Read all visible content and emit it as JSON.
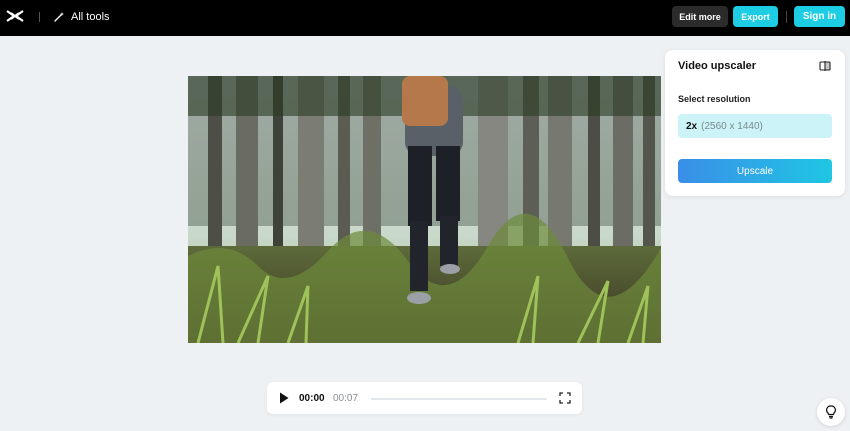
{
  "header": {
    "all_tools_label": "All tools",
    "edit_more_label": "Edit more",
    "export_label": "Export",
    "sign_in_label": "Sign in"
  },
  "panel": {
    "title": "Video upscaler",
    "resolution_label": "Select resolution",
    "resolution_multiplier": "2x",
    "resolution_dimensions": "(2560 x 1440)",
    "upscale_label": "Upscale"
  },
  "player": {
    "current_time": "00:00",
    "duration": "00:07",
    "progress": 0
  },
  "icons": [
    "capcut-logo-icon",
    "magic-wand-icon",
    "compare-icon",
    "play-icon",
    "fullscreen-icon",
    "lightbulb-icon"
  ],
  "colors": {
    "accent": "#1ccde3",
    "topbar": "#000000",
    "background": "#eef1f4",
    "selected_resolution_bg": "#ccf4f8"
  }
}
